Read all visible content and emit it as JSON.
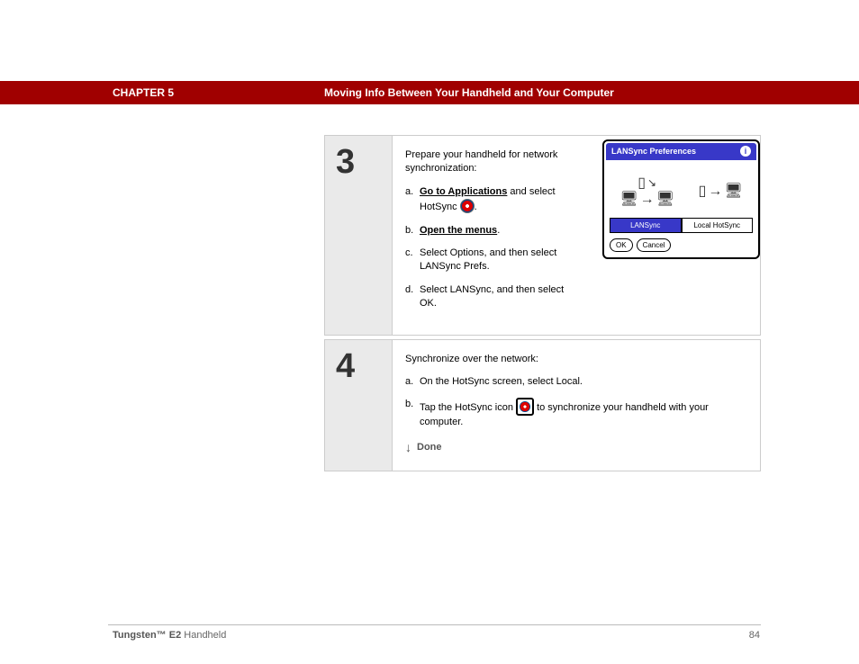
{
  "header": {
    "chapter": "CHAPTER 5",
    "running_title": "Moving Info Between Your Handheld and Your Computer"
  },
  "steps": [
    {
      "number": "3",
      "lead": "Prepare your handheld for network synchronization:",
      "items": [
        {
          "marker": "a.",
          "pre": "",
          "link": "Go to Applications",
          "post": " and select HotSync ",
          "icon": "hotsync-small",
          "tail": "."
        },
        {
          "marker": "b.",
          "pre": "",
          "link": "Open the menus",
          "post": ".",
          "icon": null,
          "tail": ""
        },
        {
          "marker": "c.",
          "pre": "Select Options, and then select LANSync Prefs.",
          "link": null,
          "post": "",
          "icon": null,
          "tail": ""
        },
        {
          "marker": "d.",
          "pre": "Select LANSync, and then select OK.",
          "link": null,
          "post": "",
          "icon": null,
          "tail": ""
        }
      ],
      "dialog": {
        "title": "LANSync Preferences",
        "tabs": [
          "LANSync",
          "Local HotSync"
        ],
        "selected_tab": 0,
        "buttons": [
          "OK",
          "Cancel"
        ]
      }
    },
    {
      "number": "4",
      "lead": "Synchronize over the network:",
      "items": [
        {
          "marker": "a.",
          "pre": "On the HotSync screen, select Local.",
          "link": null,
          "post": "",
          "icon": null,
          "tail": ""
        },
        {
          "marker": "b.",
          "pre": "Tap the HotSync icon ",
          "link": null,
          "post": "",
          "icon": "hotsync-big",
          "tail": " to synchronize your handheld with your computer."
        }
      ],
      "done_label": "Done"
    }
  ],
  "footer": {
    "product_bold": "Tungsten™ E2",
    "product_rest": " Handheld",
    "page": "84"
  }
}
